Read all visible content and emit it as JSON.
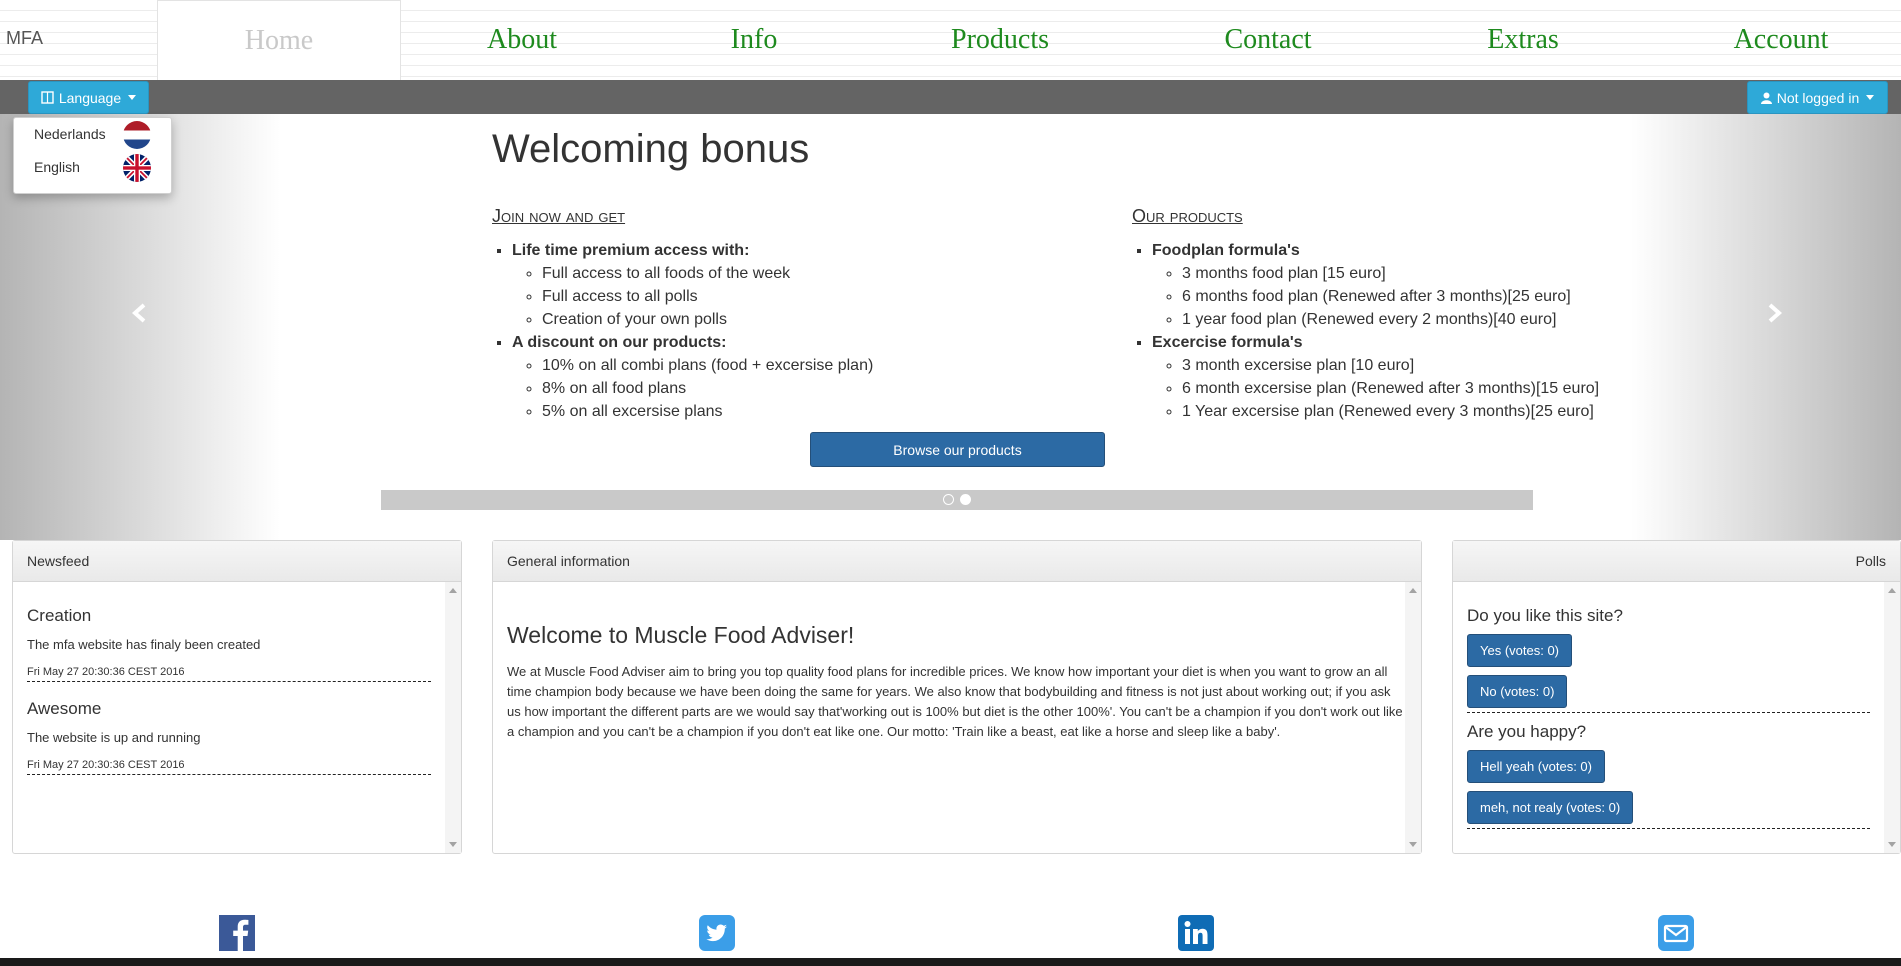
{
  "nav": {
    "brand": "MFA",
    "tabs": [
      {
        "label": "Home",
        "active": true
      },
      {
        "label": "About"
      },
      {
        "label": "Info"
      },
      {
        "label": "Products"
      },
      {
        "label": "Contact"
      },
      {
        "label": "Extras"
      },
      {
        "label": "Account"
      }
    ],
    "text_color": "#1e8a1e"
  },
  "toolbar": {
    "language_label": "Language",
    "account_label": "Not logged in",
    "accent": "#2ea9d8"
  },
  "language_menu": {
    "items": [
      {
        "label": "Nederlands",
        "flag": "flag-nl-icon"
      },
      {
        "label": "English",
        "flag": "flag-uk-icon"
      }
    ]
  },
  "carousel": {
    "title": "Welcoming bonus",
    "left_heading": "Join now and get",
    "left_groups": [
      {
        "title": "Life time premium access with:",
        "items": [
          "Full access to all foods of the week",
          "Full access to all polls",
          "Creation of your own polls"
        ]
      },
      {
        "title": "A discount on our products:",
        "items": [
          "10% on all combi plans (food + excersise plan)",
          "8% on all food plans",
          "5% on all excersise plans"
        ]
      }
    ],
    "right_heading": "Our products",
    "right_groups": [
      {
        "title": "Foodplan formula's",
        "items": [
          "3 months food plan [15 euro]",
          "6 months food plan (Renewed after 3 months)[25 euro]",
          "1 year food plan (Renewed every 2 months)[40 euro]"
        ]
      },
      {
        "title": "Excercise formula's",
        "items": [
          "3 month excersise plan [10 euro]",
          "6 month excersise plan (Renewed after 3 months)[15 euro]",
          "1 Year excersise plan (Renewed every 3 months)[25 euro]"
        ]
      }
    ],
    "browse_label": "Browse our products",
    "slide_count": 2,
    "active_slide": 2
  },
  "newsfeed": {
    "heading": "Newsfeed",
    "items": [
      {
        "title": "Creation",
        "text": "The mfa website has finaly been created",
        "date": "Fri May 27 20:30:36 CEST 2016"
      },
      {
        "title": "Awesome",
        "text": "The website is up and running",
        "date": "Fri May 27 20:30:36 CEST 2016"
      }
    ]
  },
  "general": {
    "heading": "General information",
    "title": "Welcome to Muscle Food Adviser!",
    "text": "We at Muscle Food Adviser aim to bring you top quality food plans for incredible prices. We know how important your diet is when you want to grow an all time champion body because we have been doing the same for years. We also know that bodybuilding and fitness is not just about working out; if you ask us how important the different parts are we would say that'working out is 100% but diet is the other 100%'. You can't be a champion if you don't work out like a champion and you can't be a champion if you don't eat like one. Our motto: 'Train like a beast, eat like a horse and sleep like a baby'."
  },
  "polls": {
    "heading": "Polls",
    "items": [
      {
        "question": "Do you like this site?",
        "options": [
          "Yes (votes: 0)",
          "No (votes: 0)"
        ]
      },
      {
        "question": "Are you happy?",
        "options": [
          "Hell yeah (votes: 0)",
          "meh, not realy (votes: 0)"
        ]
      }
    ]
  },
  "footer": {
    "icons": [
      "facebook-icon",
      "twitter-icon",
      "linkedin-icon",
      "mail-icon"
    ]
  }
}
